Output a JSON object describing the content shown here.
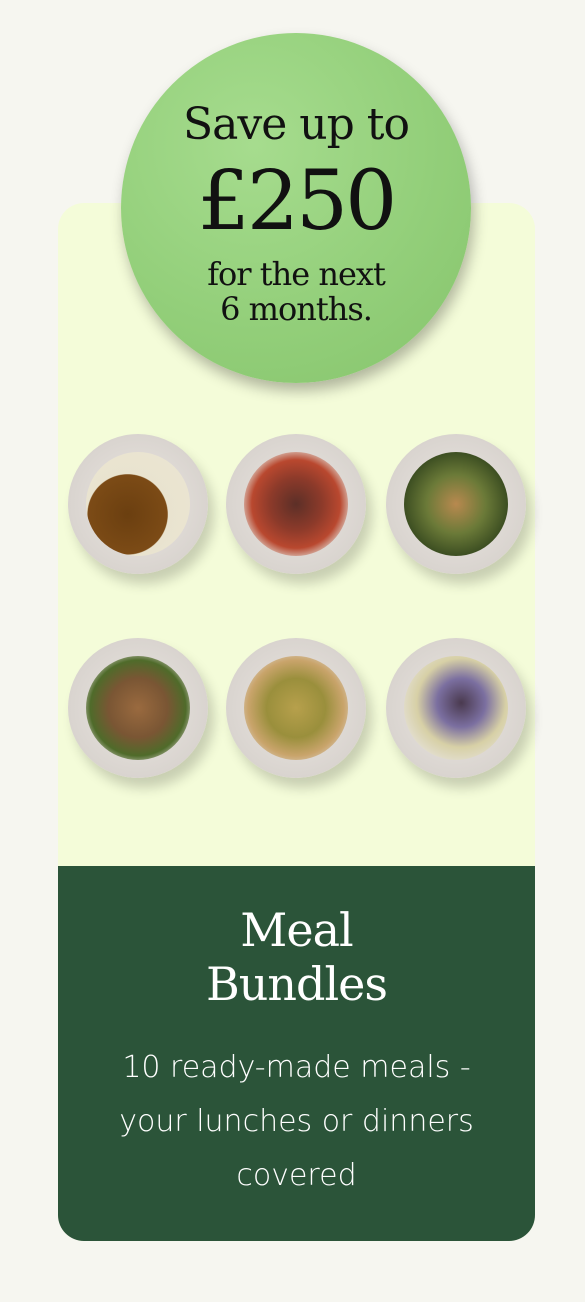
{
  "promo": {
    "line1": "Save up to",
    "amount": "£250",
    "line3": "for the next",
    "line4": "6 months."
  },
  "meals": [
    {
      "icon": "plate-rice-curry-icon"
    },
    {
      "icon": "plate-tomato-stew-icon"
    },
    {
      "icon": "plate-noodle-stirfry-icon"
    },
    {
      "icon": "plate-spaghetti-icon"
    },
    {
      "icon": "plate-rice-veg-icon"
    },
    {
      "icon": "plate-bean-salad-icon"
    }
  ],
  "bundle": {
    "title_line1": "Meal",
    "title_line2": "Bundles",
    "desc_line1": "10 ready-made meals -",
    "desc_line2": "your lunches or dinners",
    "desc_line3": "covered"
  },
  "colors": {
    "page_bg": "#f6f6f0",
    "card_bg": "#f4fcd9",
    "card_footer": "#2b5439",
    "badge": "#93cf7a"
  }
}
